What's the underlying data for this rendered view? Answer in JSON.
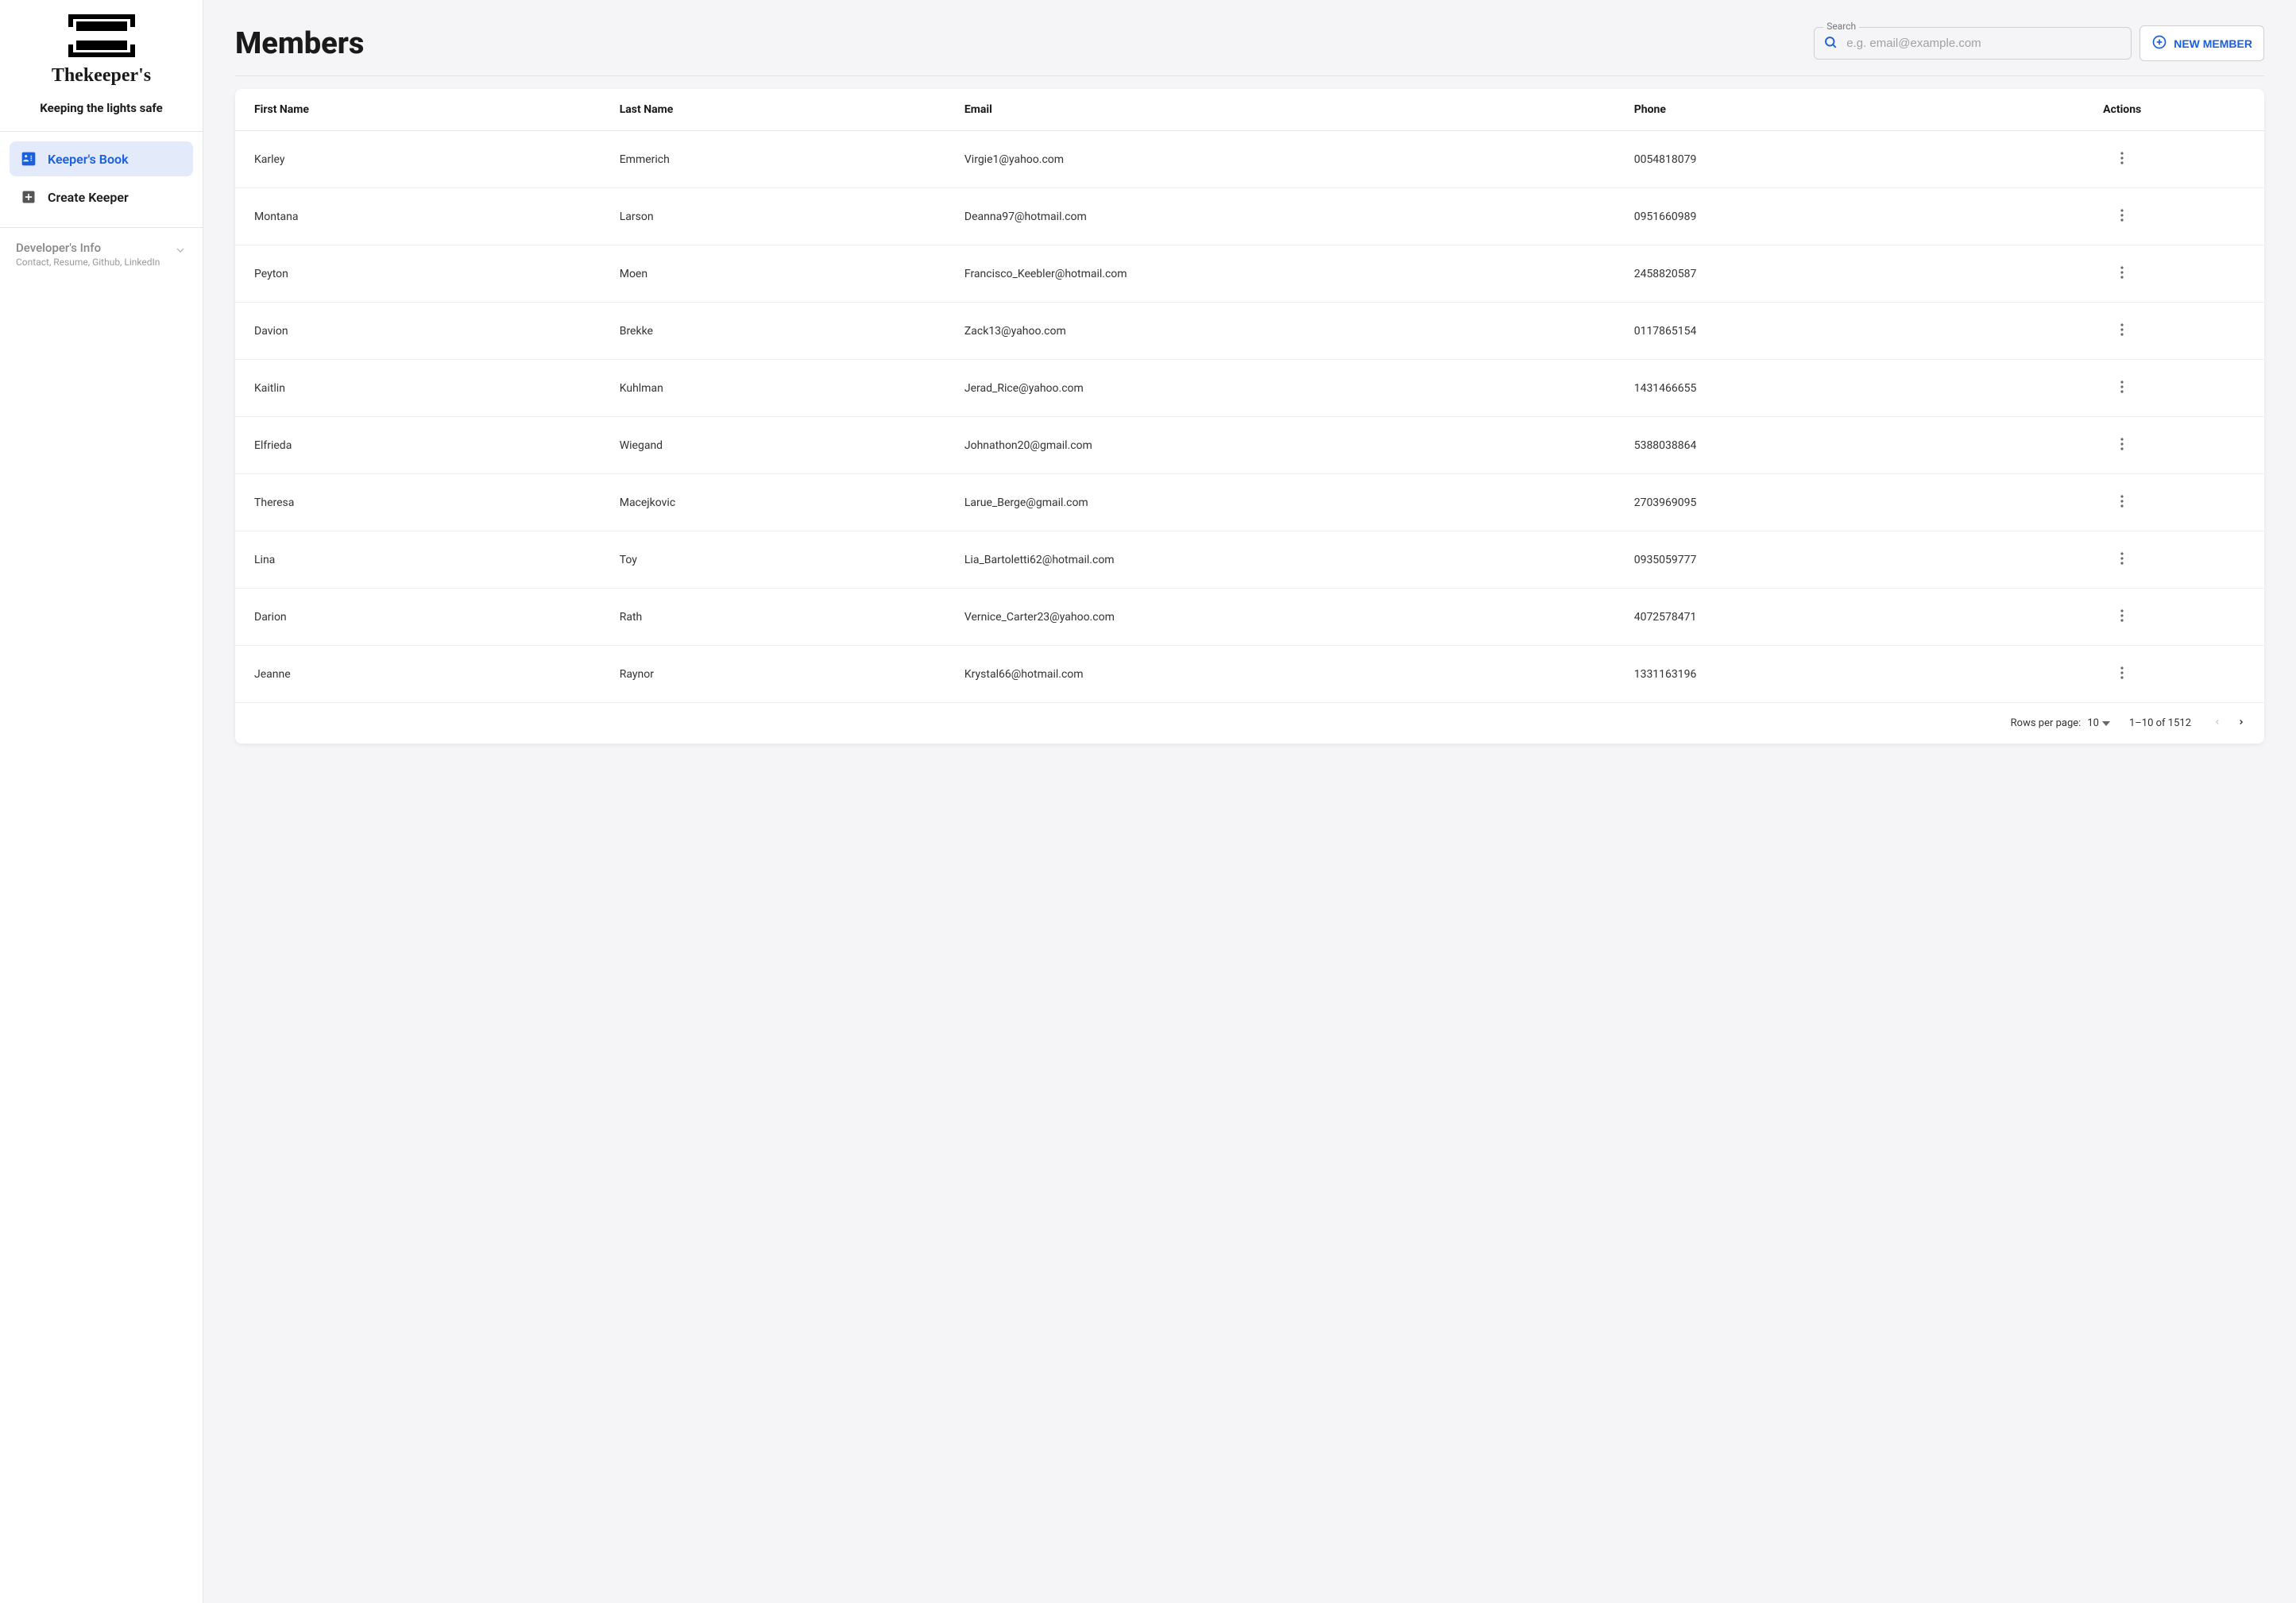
{
  "brand": {
    "name": "Thekeeper's",
    "tagline": "Keeping the lights safe"
  },
  "sidebar": {
    "items": [
      {
        "label": "Keeper's Book",
        "active": true
      },
      {
        "label": "Create Keeper",
        "active": false
      }
    ],
    "dev_info": {
      "title": "Developer's Info",
      "subtitle": "Contact, Resume, Github, LinkedIn"
    }
  },
  "page_title": "Members",
  "search": {
    "label": "Search",
    "placeholder": "e.g. email@example.com",
    "value": ""
  },
  "new_member_button": "NEW MEMBER",
  "table": {
    "columns": [
      "First Name",
      "Last Name",
      "Email",
      "Phone",
      "Actions"
    ],
    "rows": [
      {
        "first": "Karley",
        "last": "Emmerich",
        "email": "Virgie1@yahoo.com",
        "phone": "0054818079"
      },
      {
        "first": "Montana",
        "last": "Larson",
        "email": "Deanna97@hotmail.com",
        "phone": "0951660989"
      },
      {
        "first": "Peyton",
        "last": "Moen",
        "email": "Francisco_Keebler@hotmail.com",
        "phone": "2458820587"
      },
      {
        "first": "Davion",
        "last": "Brekke",
        "email": "Zack13@yahoo.com",
        "phone": "0117865154"
      },
      {
        "first": "Kaitlin",
        "last": "Kuhlman",
        "email": "Jerad_Rice@yahoo.com",
        "phone": "1431466655"
      },
      {
        "first": "Elfrieda",
        "last": "Wiegand",
        "email": "Johnathon20@gmail.com",
        "phone": "5388038864"
      },
      {
        "first": "Theresa",
        "last": "Macejkovic",
        "email": "Larue_Berge@gmail.com",
        "phone": "2703969095"
      },
      {
        "first": "Lina",
        "last": "Toy",
        "email": "Lia_Bartoletti62@hotmail.com",
        "phone": "0935059777"
      },
      {
        "first": "Darion",
        "last": "Rath",
        "email": "Vernice_Carter23@yahoo.com",
        "phone": "4072578471"
      },
      {
        "first": "Jeanne",
        "last": "Raynor",
        "email": "Krystal66@hotmail.com",
        "phone": "1331163196"
      }
    ]
  },
  "pagination": {
    "rows_per_page_label": "Rows per page:",
    "rows_per_page_value": "10",
    "page_info": "1–10 of 1512"
  }
}
